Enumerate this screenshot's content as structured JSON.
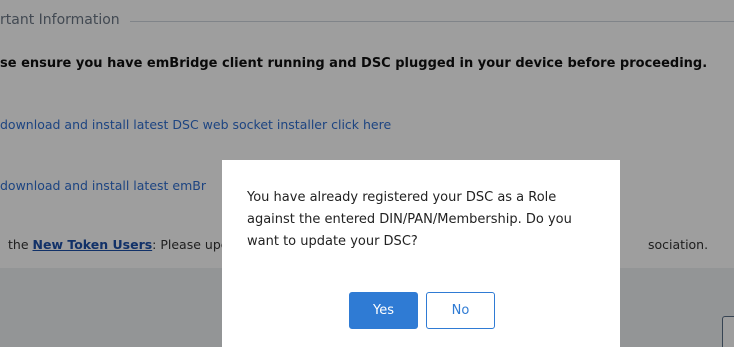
{
  "background": {
    "legend": "rtant Information",
    "notice": "se ensure you have emBridge client running and DSC plugged in your device before proceeding.",
    "link1": "download and install latest DSC web socket installer click here",
    "link2": "download and install latest emBr",
    "line3_prefix": "the ",
    "line3_link": "New Token Users",
    "line3_suffix": ": Please upc",
    "line3_tail": "sociation."
  },
  "dialog": {
    "message": "You have already registered your DSC as a Role against the entered DIN/PAN/Membership. Do you want to update your DSC?",
    "yes_label": "Yes",
    "no_label": "No"
  },
  "colors": {
    "accent": "#2f7bd4",
    "link": "#2f6fd0",
    "overlay": "rgba(0,0,0,0.38)"
  }
}
